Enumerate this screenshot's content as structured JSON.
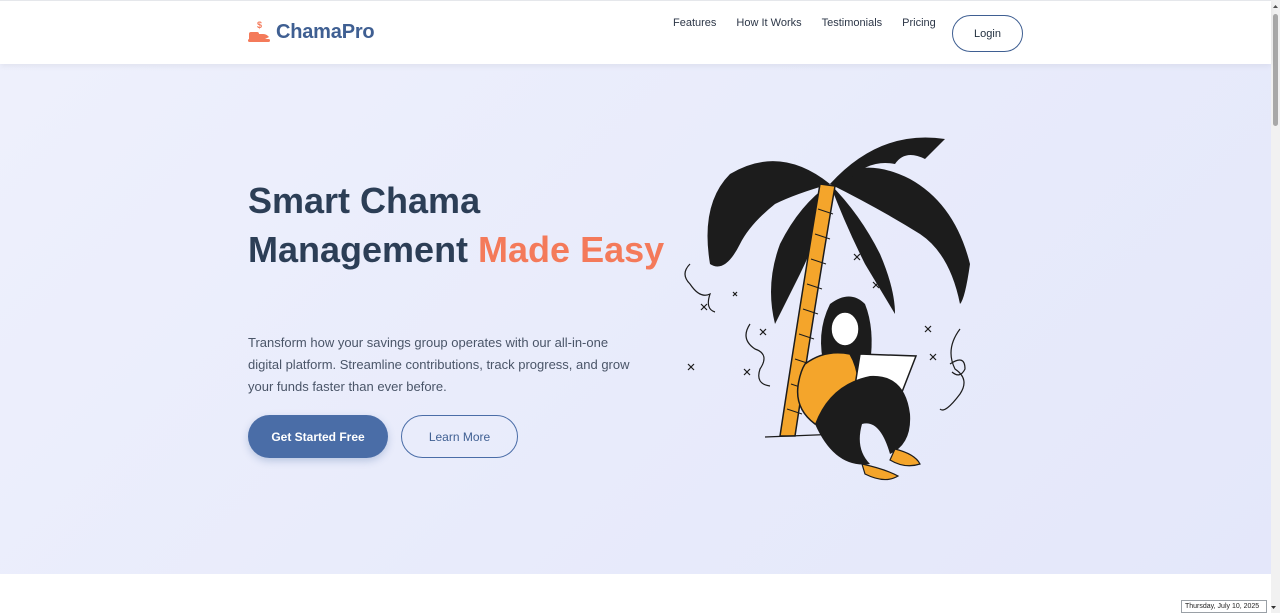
{
  "brand": {
    "name": "ChamaPro",
    "color": "#3f5f92",
    "accent": "#f47a5a",
    "icon": "hand-coin-icon"
  },
  "nav": {
    "links": [
      "Features",
      "How It Works",
      "Testimonials",
      "Pricing"
    ],
    "login_label": "Login"
  },
  "hero": {
    "title_line1": "Smart Chama",
    "title_line2": "Management ",
    "title_accent": "Made Easy",
    "subtitle": "Transform how your savings group operates with our all-in-one digital platform. Streamline contributions, track progress, and grow your funds faster than ever before.",
    "primary_cta": "Get Started Free",
    "secondary_cta": "Learn More",
    "illustration": "woman-laptop-palm-tree-illustration"
  },
  "system": {
    "date": "Thursday, July 10, 2025"
  }
}
